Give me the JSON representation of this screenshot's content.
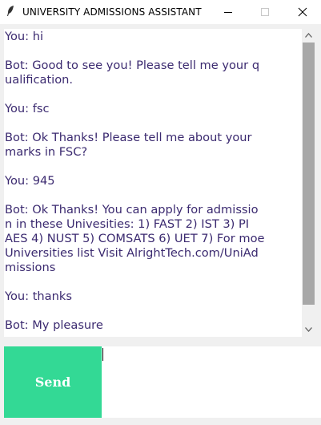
{
  "window": {
    "title": "UNIVERSITY ADMISSIONS ASSISTANT",
    "icon": "feather-icon"
  },
  "chat": {
    "transcript": "You: hi\n\nBot: Good to see you! Please tell me your q\nualification.\n\nYou: fsc\n\nBot: Ok Thanks! Please tell me about your\nmarks in FSC?\n\nYou: 945\n\nBot: Ok Thanks! You can apply for admissio\nn in these Univesities: 1) FAST 2) IST 3) PI\nAES 4) NUST 5) COMSATS 6) UET 7) For moe\nUniversities list Visit AlrightTech.com/UniAd\nmissions\n\nYou: thanks\n\nBot: My pleasure",
    "text_color": "#3b2a70"
  },
  "composer": {
    "send_label": "Send",
    "input_value": "",
    "send_color": "#33d995"
  }
}
